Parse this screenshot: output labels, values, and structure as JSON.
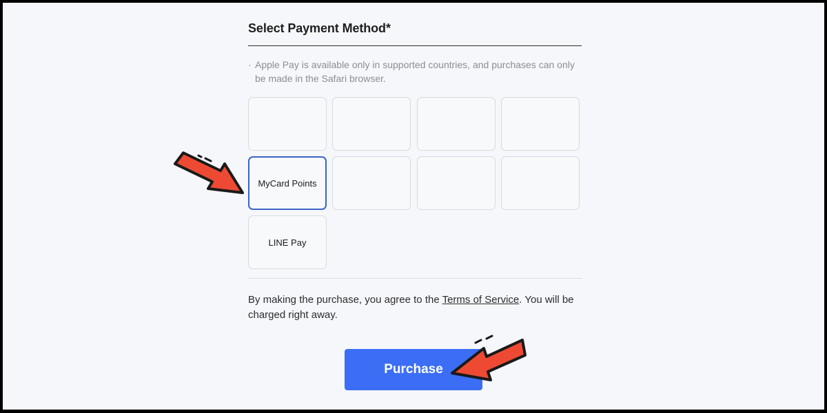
{
  "payment": {
    "title": "Select Payment Method*",
    "note_bullet": "·",
    "note": "Apple Pay is available only in supported countries, and purchases can only be made in the Safari browser.",
    "methods": [
      {
        "label": ""
      },
      {
        "label": ""
      },
      {
        "label": ""
      },
      {
        "label": ""
      },
      {
        "label": "MyCard Points",
        "selected": true
      },
      {
        "label": ""
      },
      {
        "label": ""
      },
      {
        "label": ""
      },
      {
        "label": "LINE Pay"
      }
    ]
  },
  "terms": {
    "before": "By making the purchase, you agree to the ",
    "link": "Terms of Service",
    "after": ". You will be charged right away."
  },
  "purchase_button": "Purchase",
  "colors": {
    "accent": "#3b6ef5",
    "selected_border": "#3b63c7",
    "annotation_arrow": "#ee4a33"
  }
}
